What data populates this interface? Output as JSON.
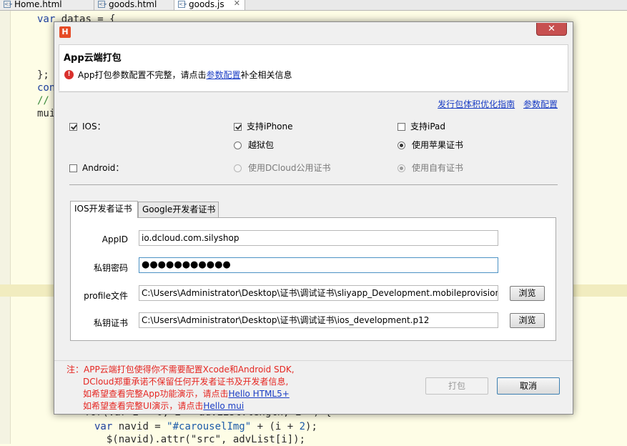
{
  "editor": {
    "tabs": [
      {
        "label": "Home.html"
      },
      {
        "label": "goods.html"
      },
      {
        "label": "goods.js",
        "close": "✕"
      }
    ],
    "code_lines": [
      {
        "kw": "var",
        "text": " datas = {"
      },
      {
        "kw": "",
        "text": "};"
      },
      {
        "kw": "con",
        "text": ""
      },
      {
        "kw": "",
        "text": "//"
      },
      {
        "kw": "",
        "text": "mui"
      },
      {
        "text": "for(var i = 0; i < advList.length; i++) {"
      },
      {
        "text": "  var navid = \"#carouselImg\" + (i + 2);"
      },
      {
        "text": "  $(navid).attr(\"src\", advList[i]);"
      }
    ]
  },
  "dialog": {
    "logo": "H",
    "close": "✕",
    "title": "App云端打包",
    "error": {
      "icon": "!",
      "before": "App打包参数配置不完整，请点击",
      "link": "参数配置",
      "after": "补全相关信息"
    },
    "links": {
      "guide": "发行包体积优化指南",
      "params": "参数配置"
    },
    "ios": {
      "label": "IOS：",
      "checked": true,
      "iphone": {
        "label": "支持iPhone",
        "checked": true
      },
      "ipad": {
        "label": "支持iPad",
        "checked": false
      },
      "jailbreak": {
        "label": "越狱包",
        "selected": false
      },
      "apple_cert": {
        "label": "使用苹果证书",
        "selected": true
      }
    },
    "android": {
      "label": "Android：",
      "checked": false,
      "dcloud_cert": {
        "label": "使用DCloud公用证书",
        "selected": false
      },
      "own_cert": {
        "label": "使用自有证书",
        "selected": true
      }
    },
    "tabs": {
      "ios": "IOS开发者证书",
      "google": "Google开发者证书"
    },
    "form": {
      "appid": {
        "label": "AppID",
        "value": "io.dcloud.com.silyshop"
      },
      "password": {
        "label": "私钥密码",
        "value": "●●●●●●●●●●●"
      },
      "profile": {
        "label": "profile文件",
        "value": "C:\\Users\\Administrator\\Desktop\\证书\\调试证书\\sliyapp_Development.mobileprovision",
        "browse": "浏览"
      },
      "cert": {
        "label": "私钥证书",
        "value": "C:\\Users\\Administrator\\Desktop\\证书\\调试证书\\ios_development.p12",
        "browse": "浏览"
      }
    },
    "note": {
      "line1": "注：APP云端打包使得你不需要配置Xcode和Android SDK,",
      "line2": "DCloud郑重承诺不保留任何开发者证书及开发者信息,",
      "line3_before": "如希望查看完整App功能演示，请点击",
      "line3_link": "Hello HTML5+",
      "line4_before": "如希望查看完整UI演示，请点击",
      "line4_link": "Hello mui"
    },
    "buttons": {
      "pack": "打包",
      "cancel": "取消"
    }
  }
}
